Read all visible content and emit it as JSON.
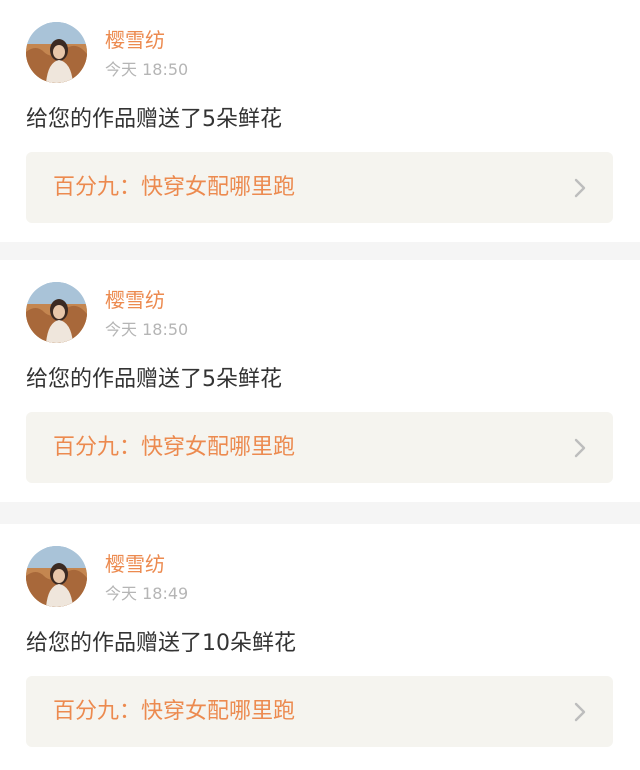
{
  "notifications": [
    {
      "username": "樱雪纺",
      "time": "今天 18:50",
      "message": "给您的作品赠送了5朵鲜花",
      "book_title": "百分九：快穿女配哪里跑"
    },
    {
      "username": "樱雪纺",
      "time": "今天 18:50",
      "message": "给您的作品赠送了5朵鲜花",
      "book_title": "百分九：快穿女配哪里跑"
    },
    {
      "username": "樱雪纺",
      "time": "今天 18:49",
      "message": "给您的作品赠送了10朵鲜花",
      "book_title": "百分九：快穿女配哪里跑"
    }
  ],
  "icons": {
    "avatar": "user-avatar-photo",
    "chevron": "chevron-right-icon"
  },
  "colors": {
    "accent": "#ec8a4f",
    "text": "#333333",
    "muted": "#b5b5b5",
    "link_bg": "#f5f4ef",
    "page_bg": "#f5f5f5"
  }
}
